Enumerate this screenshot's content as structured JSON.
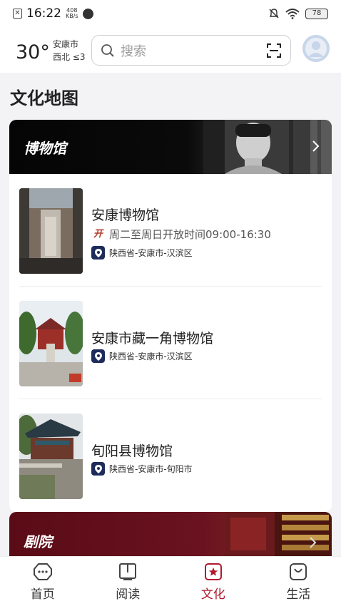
{
  "status_bar": {
    "time": "16:22",
    "net_speed_value": "408",
    "net_speed_unit": "KB/s",
    "battery": "78"
  },
  "header": {
    "temperature": "30°",
    "city": "安康市",
    "wind": "西北 ≤3",
    "search_placeholder": "搜索"
  },
  "page_title": "文化地图",
  "museums": {
    "banner_title": "博物馆",
    "items": [
      {
        "name": "安康博物馆",
        "hours_badge": "开",
        "hours": "周二至周日开放时间09:00-16:30",
        "address": "陕西省-安康市-汉滨区"
      },
      {
        "name": "安康市藏一角博物馆",
        "address": "陕西省-安康市-汉滨区"
      },
      {
        "name": "旬阳县博物馆",
        "address": "陕西省-安康市-旬阳市"
      }
    ]
  },
  "theater": {
    "banner_title": "剧院"
  },
  "bottom_nav": {
    "items": [
      {
        "label": "首页",
        "icon": "home-chat-icon",
        "active": false
      },
      {
        "label": "阅读",
        "icon": "book-icon",
        "active": false
      },
      {
        "label": "文化",
        "icon": "star-badge-icon",
        "active": true
      },
      {
        "label": "生活",
        "icon": "bag-icon",
        "active": false
      }
    ],
    "active_color": "#b0192e"
  }
}
